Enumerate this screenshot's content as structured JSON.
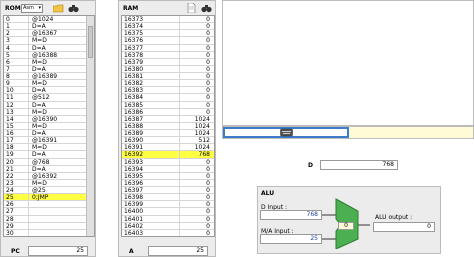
{
  "rom": {
    "title": "ROM",
    "format": "Asm",
    "rows": [
      {
        "n": "0",
        "v": "@1024",
        "hl": false
      },
      {
        "n": "1",
        "v": "D=A",
        "hl": false
      },
      {
        "n": "2",
        "v": "@16367",
        "hl": false
      },
      {
        "n": "3",
        "v": "M=D",
        "hl": false
      },
      {
        "n": "4",
        "v": "D=A",
        "hl": false
      },
      {
        "n": "5",
        "v": "@16388",
        "hl": false
      },
      {
        "n": "6",
        "v": "M=D",
        "hl": false
      },
      {
        "n": "7",
        "v": "D=A",
        "hl": false
      },
      {
        "n": "8",
        "v": "@16389",
        "hl": false
      },
      {
        "n": "9",
        "v": "M=D",
        "hl": false
      },
      {
        "n": "10",
        "v": "D=A",
        "hl": false
      },
      {
        "n": "11",
        "v": "@512",
        "hl": false
      },
      {
        "n": "12",
        "v": "D=A",
        "hl": false
      },
      {
        "n": "13",
        "v": "M=D",
        "hl": false
      },
      {
        "n": "14",
        "v": "@16390",
        "hl": false
      },
      {
        "n": "15",
        "v": "M=D",
        "hl": false
      },
      {
        "n": "16",
        "v": "D=A",
        "hl": false
      },
      {
        "n": "17",
        "v": "@16391",
        "hl": false
      },
      {
        "n": "18",
        "v": "M=D",
        "hl": false
      },
      {
        "n": "19",
        "v": "D=A",
        "hl": false
      },
      {
        "n": "20",
        "v": "@768",
        "hl": false
      },
      {
        "n": "21",
        "v": "D=A",
        "hl": false
      },
      {
        "n": "22",
        "v": "@16392",
        "hl": false
      },
      {
        "n": "23",
        "v": "M=D",
        "hl": false
      },
      {
        "n": "24",
        "v": "@25",
        "hl": false
      },
      {
        "n": "25",
        "v": "0;JMP",
        "hl": true
      },
      {
        "n": "26",
        "v": "",
        "hl": false
      },
      {
        "n": "27",
        "v": "",
        "hl": false
      },
      {
        "n": "28",
        "v": "",
        "hl": false
      },
      {
        "n": "29",
        "v": "",
        "hl": false
      },
      {
        "n": "30",
        "v": "",
        "hl": false
      }
    ]
  },
  "ram": {
    "title": "RAM",
    "rows": [
      {
        "a": "16373",
        "v": "0",
        "hl": false
      },
      {
        "a": "16374",
        "v": "0",
        "hl": false
      },
      {
        "a": "16375",
        "v": "0",
        "hl": false
      },
      {
        "a": "16376",
        "v": "0",
        "hl": false
      },
      {
        "a": "16377",
        "v": "0",
        "hl": false
      },
      {
        "a": "16378",
        "v": "0",
        "hl": false
      },
      {
        "a": "16379",
        "v": "0",
        "hl": false
      },
      {
        "a": "16380",
        "v": "0",
        "hl": false
      },
      {
        "a": "16381",
        "v": "0",
        "hl": false
      },
      {
        "a": "16382",
        "v": "0",
        "hl": false
      },
      {
        "a": "16383",
        "v": "0",
        "hl": false
      },
      {
        "a": "16384",
        "v": "0",
        "hl": false
      },
      {
        "a": "16385",
        "v": "0",
        "hl": false
      },
      {
        "a": "16386",
        "v": "0",
        "hl": false
      },
      {
        "a": "16387",
        "v": "1024",
        "hl": false
      },
      {
        "a": "16388",
        "v": "1024",
        "hl": false
      },
      {
        "a": "16389",
        "v": "1024",
        "hl": false
      },
      {
        "a": "16390",
        "v": "512",
        "hl": false
      },
      {
        "a": "16391",
        "v": "1024",
        "hl": false
      },
      {
        "a": "16392",
        "v": "768",
        "hl": true
      },
      {
        "a": "16393",
        "v": "0",
        "hl": false
      },
      {
        "a": "16394",
        "v": "0",
        "hl": false
      },
      {
        "a": "16395",
        "v": "0",
        "hl": false
      },
      {
        "a": "16396",
        "v": "0",
        "hl": false
      },
      {
        "a": "16397",
        "v": "0",
        "hl": false
      },
      {
        "a": "16398",
        "v": "0",
        "hl": false
      },
      {
        "a": "16399",
        "v": "0",
        "hl": false
      },
      {
        "a": "16400",
        "v": "0",
        "hl": false
      },
      {
        "a": "16401",
        "v": "0",
        "hl": false
      },
      {
        "a": "16402",
        "v": "0",
        "hl": false
      },
      {
        "a": "16403",
        "v": "0",
        "hl": false
      }
    ]
  },
  "pc": {
    "label": "PC",
    "value": "25"
  },
  "a": {
    "label": "A",
    "value": "25"
  },
  "d": {
    "label": "D",
    "value": "768"
  },
  "alu": {
    "title": "ALU",
    "d_input_label": "D Input :",
    "d_input_value": "768",
    "ma_input_label": "M/A Input :",
    "ma_input_value": "25",
    "center_value": "0",
    "output_label": "ALU output :",
    "output_value": "0",
    "color": "#4caf50"
  },
  "icons": {
    "open": "folder-icon",
    "find": "binoculars-icon",
    "doc": "document-icon",
    "keyboard": "keyboard-icon"
  }
}
